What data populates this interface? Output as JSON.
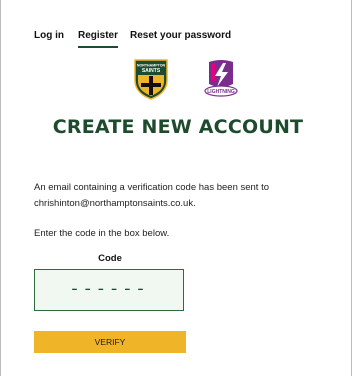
{
  "tabs": [
    {
      "label": "Log in",
      "active": false
    },
    {
      "label": "Register",
      "active": true
    },
    {
      "label": "Reset your password",
      "active": false
    }
  ],
  "logos": {
    "saints": {
      "line1": "NORTHAMPTON",
      "line2": "SAINTS",
      "colors": {
        "shield": "#1e4a2d",
        "accent": "#f0b429",
        "cross": "#111111"
      }
    },
    "lightning": {
      "text": "LIGHTNING",
      "colors": {
        "primary": "#7b2d8e",
        "secondary": "#e6007e"
      }
    }
  },
  "page": {
    "title": "CREATE NEW ACCOUNT",
    "message_line1": "An email containing a verification code has been sent to",
    "message_line2": "chrishinton@northamptonsaints.co.uk.",
    "instruction": "Enter the code in the box below."
  },
  "form": {
    "code_label": "Code",
    "code_value": "",
    "code_placeholder": "------",
    "verify_label": "VERIFY"
  },
  "colors": {
    "brand_green": "#1e4a2d",
    "button_yellow": "#f0b429",
    "input_bg": "#f1f8f1"
  }
}
